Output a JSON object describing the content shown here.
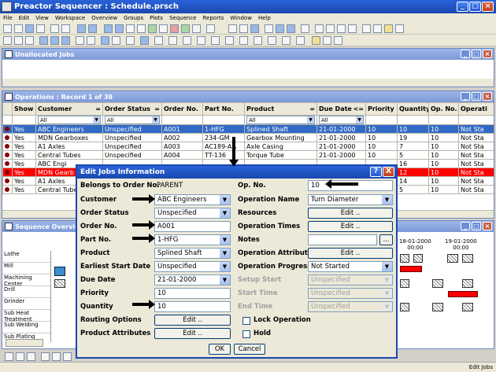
{
  "app": {
    "title": "Preactor Sequencer : Schedule.prsch"
  },
  "menu": [
    "File",
    "Edit",
    "View",
    "Workspace",
    "Overview",
    "Groups",
    "Plots",
    "Sequence",
    "Reports",
    "Window",
    "Help"
  ],
  "unallocated": {
    "title": "Unallocated Jobs"
  },
  "operations": {
    "title": "Operations : Record 1 of 38",
    "columns": [
      "Show",
      "Customer",
      "Order Status",
      "Order No.",
      "Part No.",
      "Product",
      "Due Date",
      "Priority",
      "Quantity",
      "Op. No.",
      "Operati"
    ],
    "sort_marks": {
      "customer": "=",
      "status": "=",
      "product": "=",
      "due": "<="
    },
    "filters": {
      "customer": "All",
      "status": "All",
      "product": "All",
      "due": "All"
    },
    "rows": [
      [
        "Yes",
        "ABC Engineers",
        "Unspecified",
        "A001",
        "1-HFG",
        "Splined Shaft",
        "21-01-2000",
        "10",
        "10",
        "10",
        "Not Sta"
      ],
      [
        "Yes",
        "MDN Gearboxes",
        "Unspecified",
        "A002",
        "234-GM",
        "Gearbox Mounting",
        "21-01-2000",
        "10",
        "19",
        "10",
        "Not Sta"
      ],
      [
        "Yes",
        "A1 Axles",
        "Unspecified",
        "A003",
        "AC189-AA",
        "Axle Casing",
        "21-01-2000",
        "10",
        "7",
        "10",
        "Not Sta"
      ],
      [
        "Yes",
        "Central Tubes",
        "Unspecified",
        "A004",
        "TT-136",
        "Torque Tube",
        "21-01-2000",
        "10",
        "5",
        "10",
        "Not Sta"
      ],
      [
        "Yes",
        "ABC Engi",
        "",
        "",
        "",
        "",
        "",
        "",
        "16",
        "10",
        "Not Sta"
      ],
      [
        "Yes",
        "MDN Gearb",
        "",
        "",
        "",
        "",
        "",
        "",
        "12",
        "10",
        "Not Sta"
      ],
      [
        "Yes",
        "A1 Axles",
        "",
        "",
        "",
        "",
        "",
        "",
        "14",
        "10",
        "Not Sta"
      ],
      [
        "Yes",
        "Central Tube",
        "",
        "",
        "",
        "",
        "",
        "",
        "5",
        "10",
        "Not Sta"
      ]
    ]
  },
  "sequence": {
    "title": "Sequence Overview",
    "dates": [
      {
        "d": "18-01-2000",
        "t": "00:00"
      },
      {
        "d": "19-01-2000",
        "t": "00:00"
      }
    ],
    "resources": [
      "Lathe",
      "Mill",
      "Machining Center",
      "Drill",
      "Grinder",
      "Sub Heat Treatment",
      "Sub Welding",
      "Sub Plating"
    ]
  },
  "dialog": {
    "title": "Edit Jobs Information",
    "belongs_label": "Belongs to Order No.",
    "belongs_value": "PARENT",
    "customer_label": "Customer",
    "customer": "ABC Engineers",
    "status_label": "Order Status",
    "status": "Unspecified",
    "orderno_label": "Order No.",
    "orderno": "A001",
    "partno_label": "Part No.",
    "partno": "1-HFG",
    "product_label": "Product",
    "product": "Splined Shaft",
    "est_label": "Earliest Start Date",
    "est": "Unspecified",
    "due_label": "Due Date",
    "due": "21-01-2000",
    "priority_label": "Priority",
    "priority": "10",
    "quantity_label": "Quantity",
    "quantity": "10",
    "routing_label": "Routing Options",
    "prodattr_label": "Product Attributes",
    "opno_label": "Op. No.",
    "opno": "10",
    "opname_label": "Operation Name",
    "opname": "Turn Diameter",
    "resources_label": "Resources",
    "optimes_label": "Operation Times",
    "notes_label": "Notes",
    "opattr_label": "Operation Attributes",
    "progress_label": "Operation Progress",
    "progress": "Not Started",
    "setup_label": "Setup Start",
    "setup": "Unspecified",
    "start_label": "Start Time",
    "start": "Unspecified",
    "end_label": "End Time",
    "end": "Unspecified",
    "edit_btn": "Edit ..",
    "browse_btn": "...",
    "lock_label": "Lock Operation",
    "hold_label": "Hold",
    "ok": "OK",
    "cancel": "Cancel",
    "help": "?",
    "close": "X"
  },
  "status": {
    "text": "Edit Jobs"
  }
}
